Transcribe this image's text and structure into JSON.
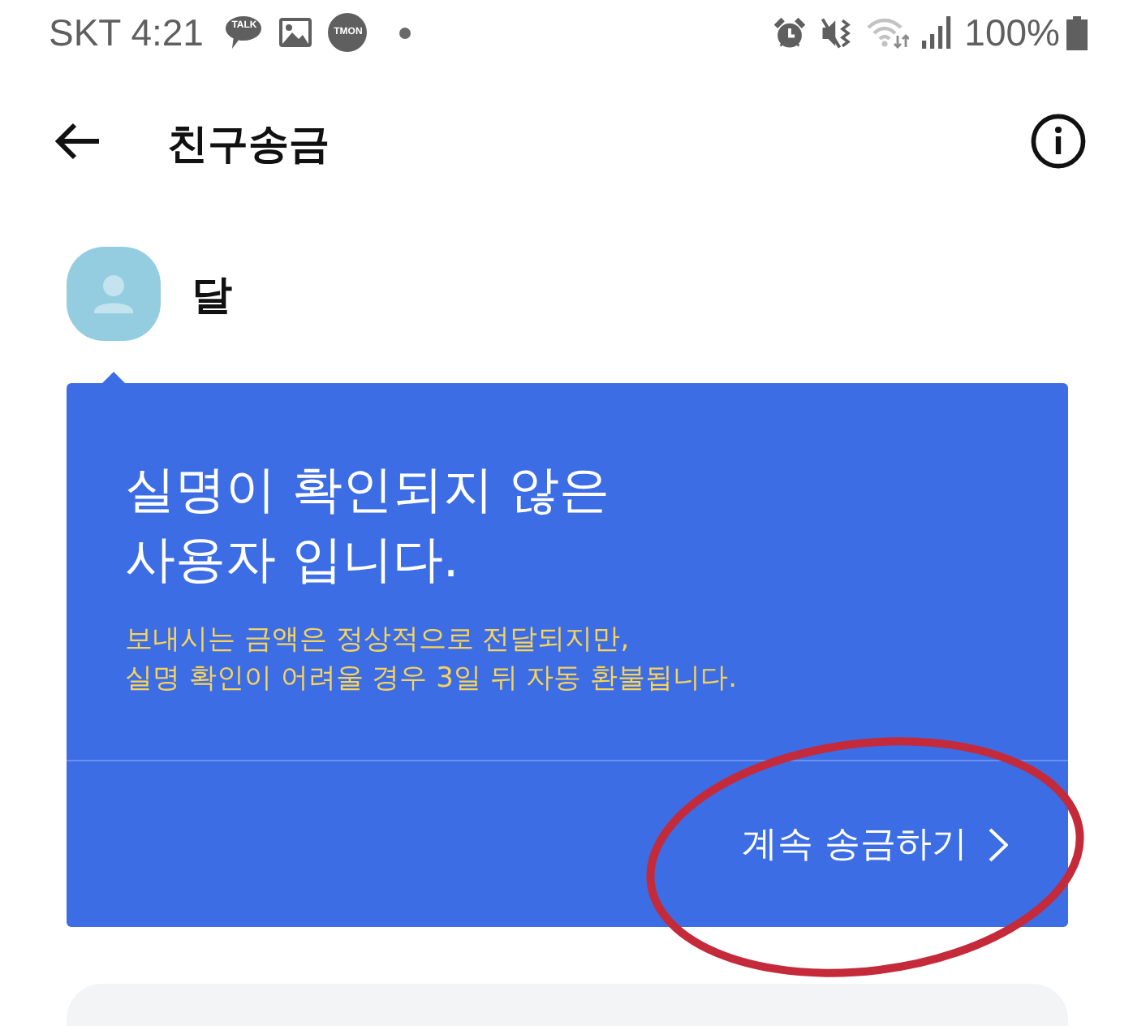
{
  "status_bar": {
    "carrier_time": "SKT 4:21",
    "notifications": [
      {
        "kind": "bubble",
        "label": "TALK"
      },
      {
        "kind": "image"
      },
      {
        "kind": "badge",
        "label": "TMON"
      },
      {
        "kind": "dot"
      }
    ],
    "battery_text": "100%"
  },
  "header": {
    "title": "친구송금"
  },
  "recipient": {
    "name": "달"
  },
  "notice": {
    "title": "실명이 확인되지 않은\n사용자 입니다.",
    "message": "보내시는 금액은 정상적으로 전달되지만,\n실명 확인이 어려울 경우 3일 뒤 자동 환불됩니다.",
    "action": {
      "label": "계속 송금하기"
    }
  }
}
